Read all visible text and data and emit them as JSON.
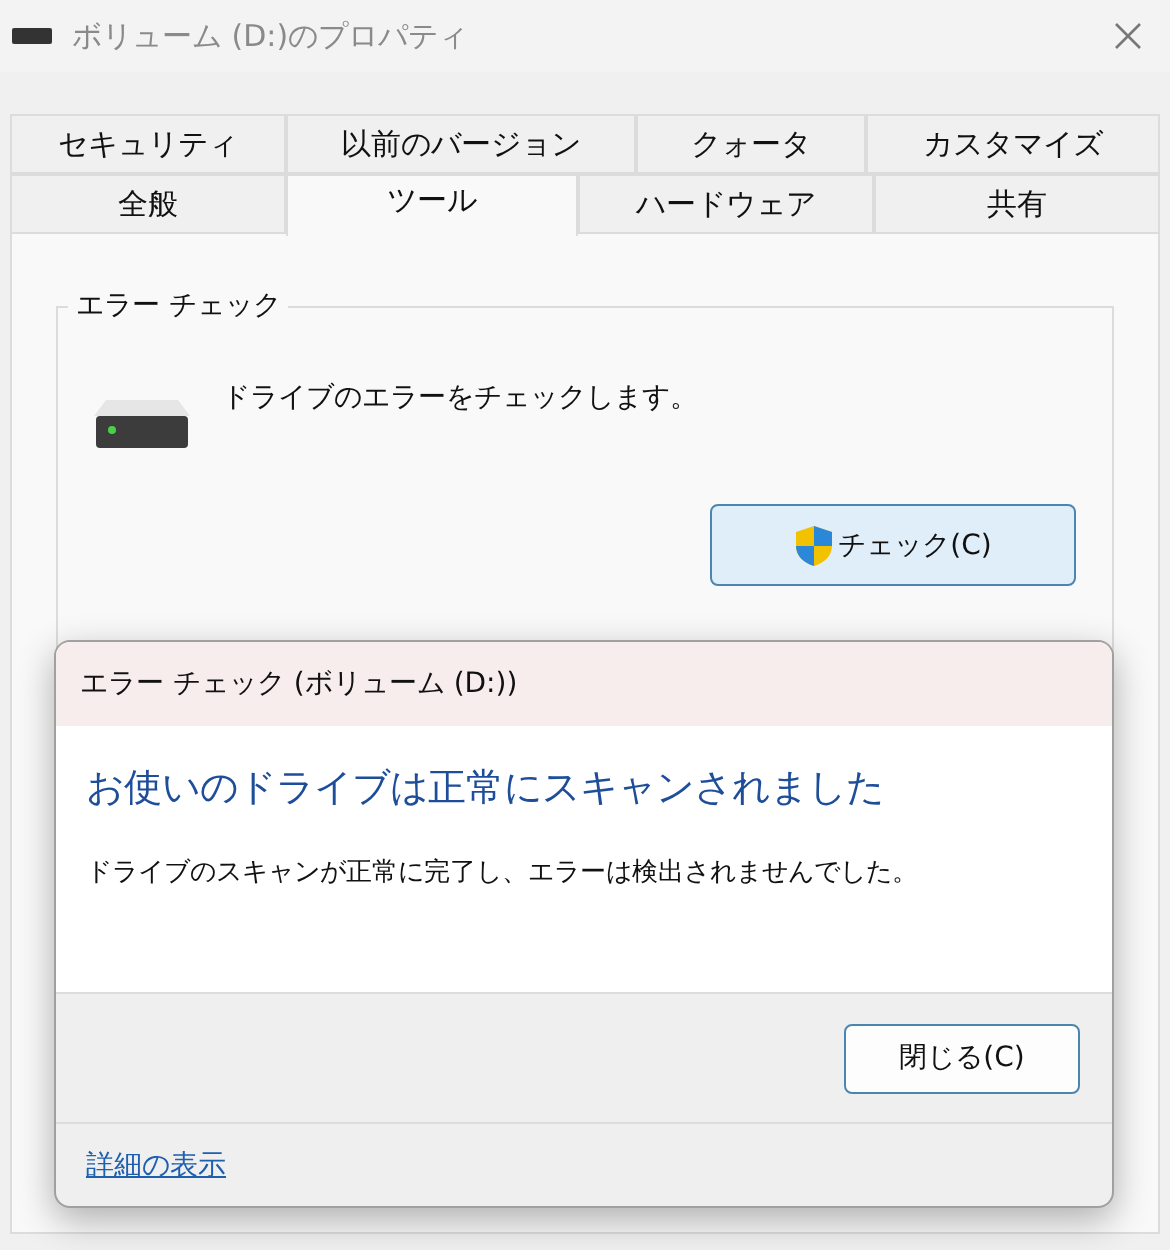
{
  "window": {
    "title": "ボリューム (D:)のプロパティ"
  },
  "tab_rows": [
    [
      {
        "label": "セキュリティ",
        "selected": false
      },
      {
        "label": "以前のバージョン",
        "selected": false
      },
      {
        "label": "クォータ",
        "selected": false
      },
      {
        "label": "カスタマイズ",
        "selected": false
      }
    ],
    [
      {
        "label": "全般",
        "selected": false
      },
      {
        "label": "ツール",
        "selected": true
      },
      {
        "label": "ハードウェア",
        "selected": false
      },
      {
        "label": "共有",
        "selected": false
      }
    ]
  ],
  "error_check": {
    "title": "エラー チェック",
    "description": "ドライブのエラーをチェックします。",
    "button": "チェック(C)"
  },
  "dialog": {
    "title": "エラー チェック (ボリューム (D:))",
    "heading": "お使いのドライブは正常にスキャンされました",
    "message": "ドライブのスキャンが正常に完了し、エラーは検出されませんでした。",
    "close_button": "閉じる(C)",
    "details_link": "詳細の表示"
  }
}
